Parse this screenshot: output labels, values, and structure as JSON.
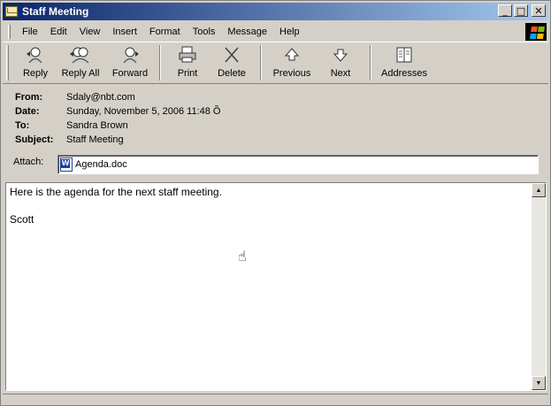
{
  "window": {
    "title": "Staff Meeting"
  },
  "titlebar": {
    "minimize": "_",
    "maximize": "□",
    "close": "✕"
  },
  "menu": [
    {
      "key": "F",
      "rest": "ile"
    },
    {
      "key": "E",
      "rest": "dit"
    },
    {
      "key": "V",
      "rest": "iew"
    },
    {
      "key": "I",
      "rest": "nsert"
    },
    {
      "key": "",
      "pre": "F",
      "u": "o",
      "post": "rmat"
    },
    {
      "key": "T",
      "rest": "ools"
    },
    {
      "key": "M",
      "rest": "essage"
    },
    {
      "key": "H",
      "rest": "elp"
    }
  ],
  "menu_labels": {
    "file": "File",
    "edit": "Edit",
    "view": "View",
    "insert": "Insert",
    "format": "Format",
    "tools": "Tools",
    "message": "Message",
    "help": "Help"
  },
  "toolbar": {
    "reply": "Reply",
    "reply_all": "Reply All",
    "forward": "Forward",
    "print": "Print",
    "delete": "Delete",
    "previous": "Previous",
    "next": "Next",
    "addresses": "Addresses"
  },
  "headers": {
    "from_label": "From:",
    "from": "Sdaly@nbt.com",
    "date_label": "Date:",
    "date": "Sunday, November 5, 2006 11:48 Õ",
    "to_label": "To:",
    "to": "Sandra Brown",
    "subject_label": "Subject:",
    "subject": "Staff Meeting"
  },
  "attach": {
    "label": "Attach:",
    "file": "Agenda.doc"
  },
  "body": {
    "line1": "Here is the agenda for the next staff meeting.",
    "signature": "Scott"
  },
  "icons": {
    "reply": "reply-icon",
    "reply_all": "reply-all-icon",
    "forward": "forward-icon",
    "print": "printer-icon",
    "delete": "delete-x-icon",
    "previous": "up-arrow-icon",
    "next": "down-arrow-icon",
    "addresses": "address-book-icon"
  }
}
